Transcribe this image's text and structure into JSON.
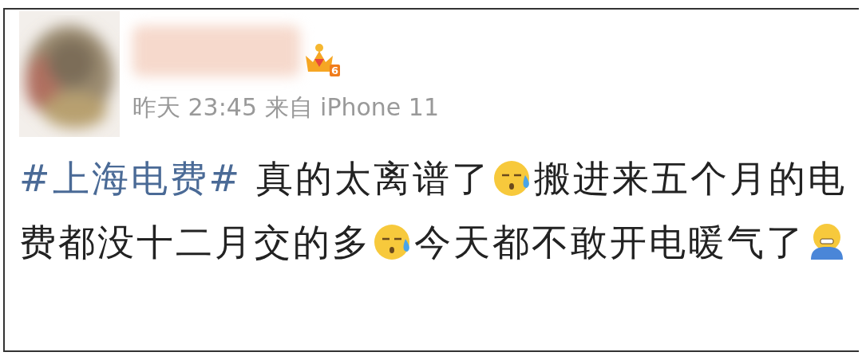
{
  "post": {
    "name_redacted": true,
    "level_badge": "6",
    "meta": "昨天 23:45 来自 iPhone 11",
    "body": [
      {
        "kind": "hashtag",
        "text": "#上海电费#"
      },
      {
        "kind": "text",
        "text": " 真的太离谱了"
      },
      {
        "kind": "sweat"
      },
      {
        "kind": "text",
        "text": "搬进来五个月的电费都没十二月交的多"
      },
      {
        "kind": "sweat"
      },
      {
        "kind": "text",
        "text": "今天都不敢开电暖气了"
      },
      {
        "kind": "cold"
      }
    ]
  }
}
